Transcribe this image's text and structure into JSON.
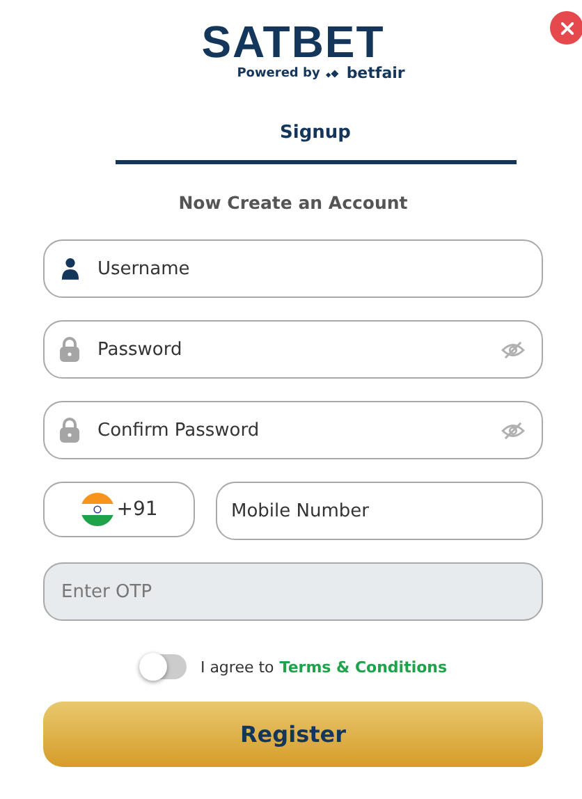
{
  "logo": {
    "brand": "SATBET",
    "tagline": "Powered by",
    "partner": "betfair"
  },
  "tabs": [
    {
      "label": "Signup",
      "selected": true
    }
  ],
  "heading": "Now Create an Account",
  "fields": [
    {
      "kind": "user",
      "placeholder": "Username"
    },
    {
      "kind": "password",
      "placeholder": "Password"
    },
    {
      "kind": "password",
      "placeholder": "Confirm Password"
    }
  ],
  "phone": {
    "code": "+91",
    "placeholder": "Mobile Number"
  },
  "otp": {
    "placeholder": "Enter OTP",
    "disabled": true
  },
  "agree": {
    "on": false,
    "text": "I agree to",
    "link": "Terms & Conditions"
  },
  "submit": "Register"
}
